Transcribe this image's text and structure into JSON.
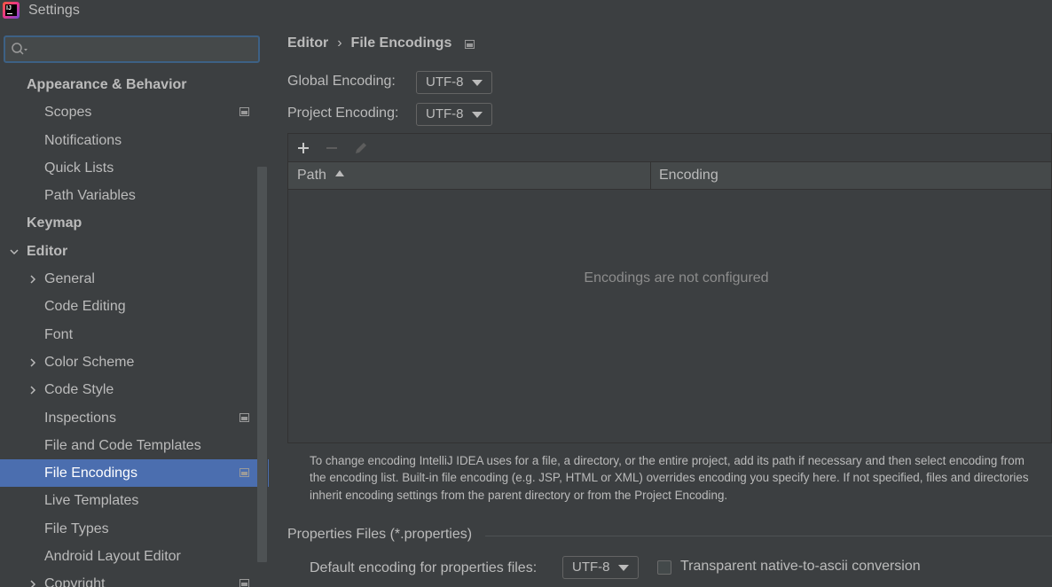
{
  "window": {
    "title": "Settings"
  },
  "search": {
    "value": "",
    "placeholder": ""
  },
  "sidebar": {
    "items": [
      {
        "label": "Appearance & Behavior"
      },
      {
        "label": "Scopes"
      },
      {
        "label": "Notifications"
      },
      {
        "label": "Quick Lists"
      },
      {
        "label": "Path Variables"
      },
      {
        "label": "Keymap"
      },
      {
        "label": "Editor"
      },
      {
        "label": "General"
      },
      {
        "label": "Code Editing"
      },
      {
        "label": "Font"
      },
      {
        "label": "Color Scheme"
      },
      {
        "label": "Code Style"
      },
      {
        "label": "Inspections"
      },
      {
        "label": "File and Code Templates"
      },
      {
        "label": "File Encodings"
      },
      {
        "label": "Live Templates"
      },
      {
        "label": "File Types"
      },
      {
        "label": "Android Layout Editor"
      },
      {
        "label": "Copyright"
      }
    ]
  },
  "breadcrumb": {
    "parent": "Editor",
    "separator": "›",
    "current": "File Encodings"
  },
  "global_encoding": {
    "label": "Global Encoding:",
    "value": "UTF-8"
  },
  "project_encoding": {
    "label": "Project Encoding:",
    "value": "UTF-8"
  },
  "table": {
    "columns": [
      {
        "label": "Path"
      },
      {
        "label": "Encoding"
      }
    ],
    "empty_text": "Encodings are not configured"
  },
  "help": {
    "line1": "To change encoding IntelliJ IDEA uses for a file, a directory, or the entire project, add its path if necessary and then select encoding from",
    "line2": "the encoding list. Built-in file encoding (e.g. JSP, HTML or XML) overrides encoding you specify here. If not specified, files and directories",
    "line3": "inherit encoding settings from the parent directory or from the Project Encoding."
  },
  "properties": {
    "section_title": "Properties Files (*.properties)",
    "default_label": "Default encoding for properties files:",
    "default_value": "UTF-8",
    "transparent_label": "Transparent native-to-ascii conversion"
  },
  "colors": {
    "selection": "#4b6eaf",
    "background": "#3c3f41",
    "focus_border": "#3d6185"
  }
}
